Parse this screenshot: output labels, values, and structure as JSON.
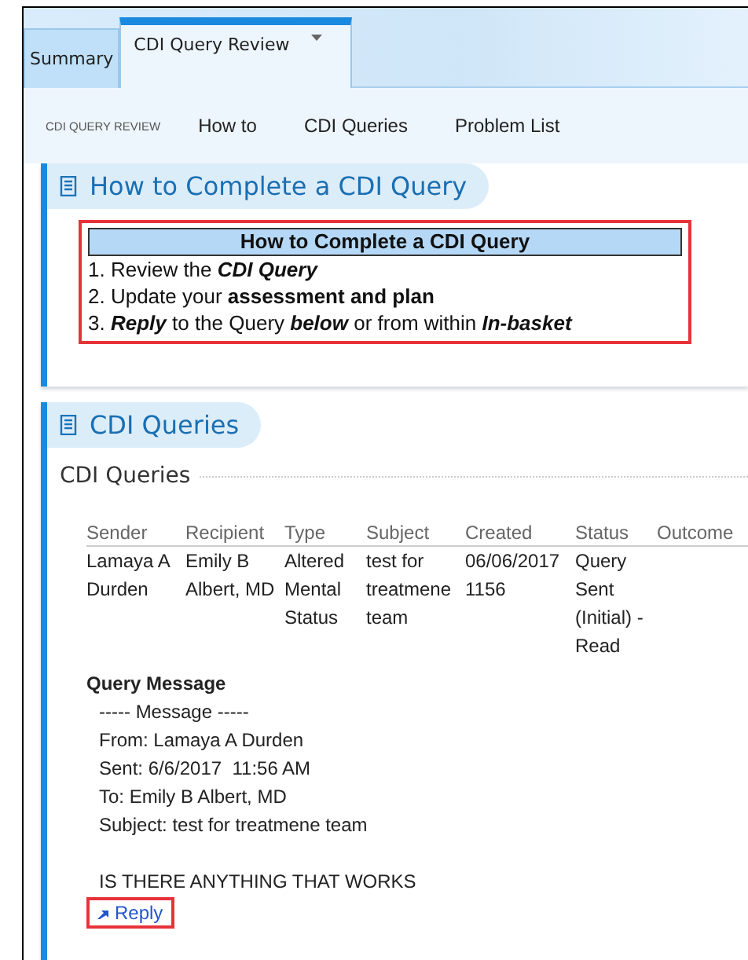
{
  "tabs": [
    {
      "label": "Summary",
      "selected": false,
      "has_menu": false
    },
    {
      "label": "CDI Query Review",
      "selected": true,
      "has_menu": true
    }
  ],
  "nav": {
    "title": "CDI QUERY REVIEW",
    "links": [
      "How to",
      "CDI Queries",
      "Problem List"
    ]
  },
  "how_to": {
    "heading": "How to Complete a CDI Query",
    "box_title": "How to Complete a CDI Query",
    "steps": [
      "1. Review the *CDI Query*",
      "2. Update your **assessment and plan**",
      "3. *Reply* to the Query *below* or from within *In-basket*"
    ]
  },
  "queries": {
    "heading": "CDI Queries",
    "subheading": "CDI Queries",
    "columns": [
      "Sender",
      "Recipient",
      "Type",
      "Subject",
      "Created",
      "Status",
      "Outcome"
    ],
    "rows": [
      {
        "cells": [
          "Lamaya A Durden",
          "Emily B Albert, MD",
          "Altered Mental Status",
          "test for treatmene team",
          "06/06/2017 1156",
          "Query Sent (Initial) - Read"
        ]
      }
    ],
    "message_label": "Query Message",
    "message_paragraphs": [
      [
        "----- Message -----",
        "From: Lamaya A Durden",
        "Sent: 6/6/2017  11:56 AM",
        "To: Emily B Albert, MD",
        "Subject: test for treatmene team"
      ],
      [
        "IS THERE ANYTHING THAT WORKS"
      ]
    ],
    "reply": "Reply"
  }
}
